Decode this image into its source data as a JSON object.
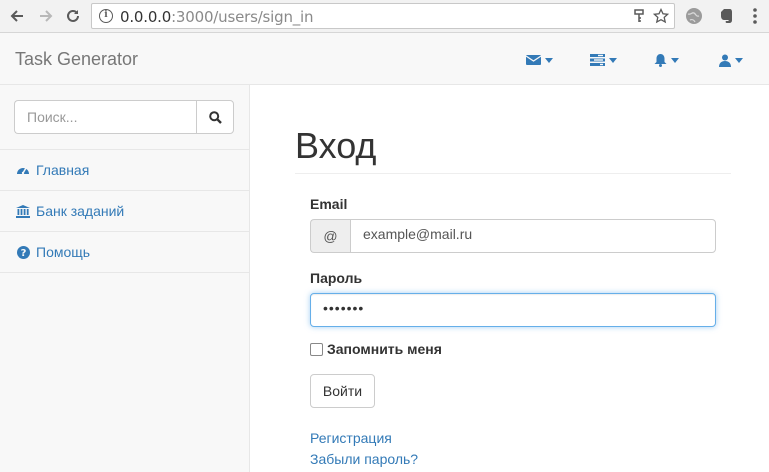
{
  "browser": {
    "url_host": "0.0.0.0",
    "url_rest": ":3000/users/sign_in"
  },
  "navbar": {
    "brand": "Task Generator",
    "menus": [
      "envelope-icon",
      "tasks-icon",
      "bell-icon",
      "user-icon"
    ]
  },
  "sidebar": {
    "search_placeholder": "Поиск...",
    "items": [
      {
        "label": "Главная",
        "icon": "dashboard-icon"
      },
      {
        "label": "Банк заданий",
        "icon": "bank-icon"
      },
      {
        "label": "Помощь",
        "icon": "question-icon"
      }
    ]
  },
  "form": {
    "title": "Вход",
    "email_label": "Email",
    "email_addon": "@",
    "email_value": "example@mail.ru",
    "password_label": "Пароль",
    "password_value": "•••••••",
    "remember_label": "Запомнить меня",
    "submit_label": "Войти",
    "register_link": "Регистрация",
    "forgot_link": "Забыли пароль?"
  },
  "colors": {
    "link": "#337ab7",
    "navbar_bg": "#f8f8f8",
    "focus_border": "#66afe9"
  }
}
